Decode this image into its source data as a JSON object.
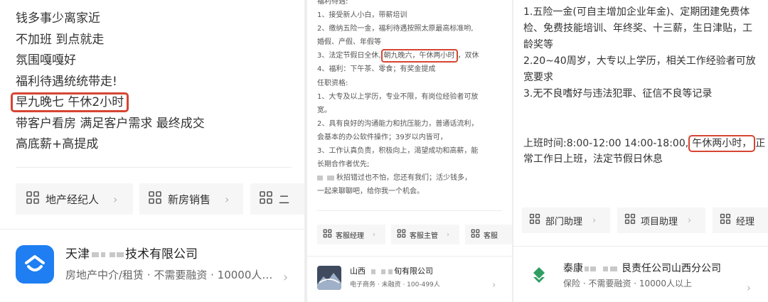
{
  "left_panel": {
    "lines": [
      "钱多事少离家近",
      "不加班 到点就走",
      "氛围嘎嘎好",
      "福利待遇统统带走!",
      "早九晚七 午休2小时",
      "带客户看房 满足客户需求 最终成交",
      "高底薪+高提成"
    ],
    "tags": [
      "地产经纪人",
      "新房销售",
      "二"
    ],
    "company": {
      "name_start": "天津",
      "name_end": "技术有限公司",
      "meta": "房地产中介/租赁 · 不需要融资 · 10000人…"
    }
  },
  "middle_panel": {
    "lines": {
      "l0": "福利待遇:",
      "l1": "1、接受新人小白，带薪培训",
      "l2": "2、缴纳五险一金，福利待遇按照太原最高标准哟,",
      "l3": "婚假、产假、年假等",
      "l4_pre": "3、法定节假日全休,",
      "l4_hl": "朝九晚六，午休两小时",
      "l4_post": "，双休",
      "l5": "4、福利：下午茶、零食；有奖金提成",
      "l6": "任职资格:",
      "l7": "1、大专及以上学历，专业不限，有岗位经验者可放",
      "l8": "宽。",
      "l9": "2、具有良好的沟通能力和抗压能力，普通话流利，",
      "l10": "会基本的办公软件操作；39岁以内皆可，",
      "l11": "3、工作认真负责，积极向上，渴望成功和高薪，能",
      "l12": "长期合作者优先;",
      "l13": "秋招错过也不怕，您还有我们；活少钱多，",
      "l14": "一起来聊聊吧，给你我一个机会。"
    },
    "tags": [
      "客服经理",
      "客服主管",
      "客服"
    ],
    "company": {
      "name_start": "山西",
      "name_end": "旬有限公司",
      "meta": "电子商务 · 未融资 · 100-499人"
    }
  },
  "right_panel": {
    "lines": {
      "l1": "1.五险一金(可自主增加企业年金)、定期团建免费体",
      "l2": "检、免费技能培训、年终奖、十三薪，生日津贴，工",
      "l3": "龄奖等",
      "l4": "2.20~40周岁，大专以上学历，相关工作经验者可放",
      "l5": "宽要求",
      "l6": "3.无不良嗜好与违法犯罪、征信不良等记录",
      "l7_pre": "上班时间:8:00-12:00 14:00-18:00,",
      "l7_hl": "午休两小时，",
      "l7_post": "正",
      "l8": "常工作日上班，法定节假日休息"
    },
    "tags": [
      "部门助理",
      "项目助理",
      "经理"
    ],
    "company": {
      "name_start": "泰康",
      "name_end": "艮责任公司山西分公司",
      "meta": "保险 · 不需要融资 · 10000人以上"
    }
  },
  "icons": {
    "tag_icon": "category-grid-icon",
    "chevron": "chevron-right-icon"
  },
  "colors": {
    "highlight_border": "#d64533",
    "company1_logo": "#1e7ef2",
    "company3_logo": "#2f9e62"
  }
}
